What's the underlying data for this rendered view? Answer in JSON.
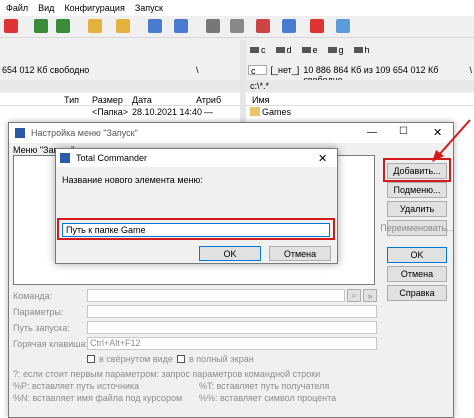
{
  "menubar": {
    "items": [
      "Файл",
      "Вид",
      "Конфигурация",
      "Запуск"
    ]
  },
  "drives_right": [
    "c",
    "d",
    "e",
    "g",
    "h"
  ],
  "left_panel": {
    "free_text": "654 012 Кб свободно",
    "backslash": "\\",
    "columns": {
      "type": "Тип",
      "size": "Размер",
      "date": "Дата",
      "attr": "Атриб"
    },
    "first_row": {
      "size": "<Папка>",
      "date": "28.10.2021 14:40",
      "attr": "—"
    }
  },
  "right_panel": {
    "drive": "c",
    "label": "[_нет_]",
    "free_text": "10 886 864 Кб из 109 654 012 Кб свободно",
    "backslash": "\\",
    "path": "c:\\*.*",
    "columns": {
      "name": "Имя"
    },
    "first_row": "Games"
  },
  "dialog1": {
    "title": "Настройка меню \"Запуск\"",
    "menu_label": "Меню \"Запуск\":",
    "buttons": {
      "add": "Добавить...",
      "submenu": "Подменю...",
      "delete": "Удалить",
      "rename": "Переименовать...",
      "ok": "OK",
      "cancel": "Отмена",
      "help": "Справка"
    },
    "fields": {
      "command": "Команда:",
      "params": "Параметры:",
      "start_path": "Путь запуска:",
      "hotkey": "Горячая клавиша:",
      "hotkey_value": "Ctrl+Alt+F12"
    },
    "checkboxes": {
      "minimized": "в свёрнутом виде",
      "fullscreen": "в полный экран"
    },
    "hints": {
      "line1": "?: если стоит первым параметром: запрос параметров командной строки",
      "p_src": "%P: вставляет путь источника",
      "p_dst": "%T: вставляет путь получателя",
      "n_cursor": "%N: вставляет имя файла под курсором",
      "s_selected": "%%: вставляет символ процента"
    }
  },
  "dialog2": {
    "title": "Total Commander",
    "prompt": "Название нового элемента меню:",
    "input_value": "Путь к папке Game",
    "ok": "OK",
    "cancel": "Отмена"
  },
  "colors": {
    "highlight_red": "#d41a1a",
    "ok_border": "#0078d7"
  }
}
